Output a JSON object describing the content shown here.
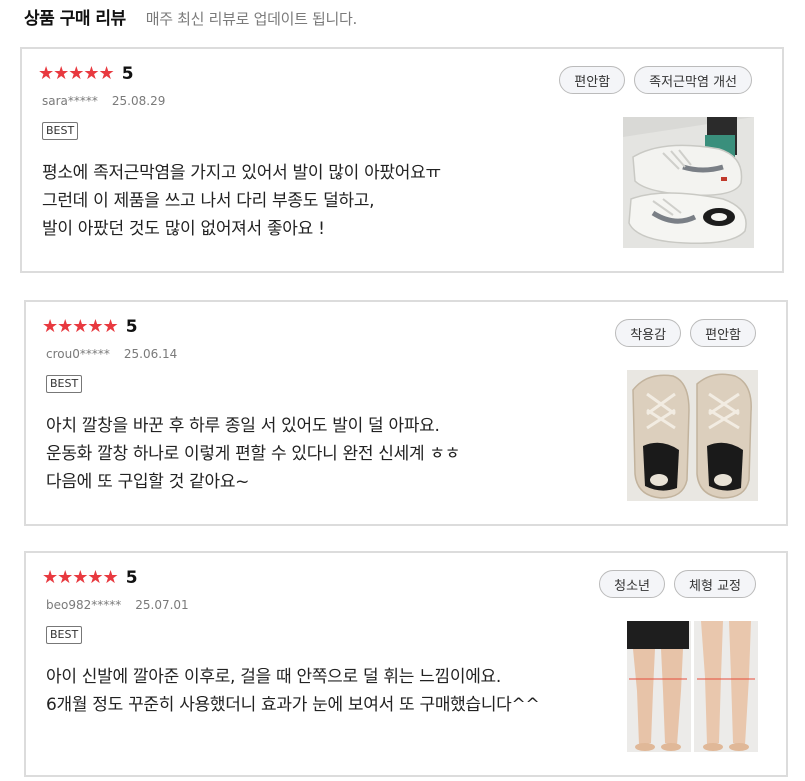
{
  "header": {
    "title": "상품 구매 리뷰",
    "subtitle": "매주 최신 리뷰로 업데이트 됩니다."
  },
  "reviews": [
    {
      "stars": "★★★★★",
      "score": "5",
      "user": "sara*****",
      "date": "25.08.29",
      "badge": "BEST",
      "tags": [
        "편안함",
        "족저근막염 개선"
      ],
      "lines": [
        "평소에 족저근막염을 가지고 있어서 발이 많이 아팠어요ㅠ",
        "그런데 이 제품을 쓰고 나서 다리 부종도 덜하고,",
        "발이 아팠던 것도 많이 없어져서 좋아요 !"
      ]
    },
    {
      "stars": "★★★★★",
      "score": "5",
      "user": "crou0*****",
      "date": "25.06.14",
      "badge": "BEST",
      "tags": [
        "착용감",
        "편안함"
      ],
      "lines": [
        "아치 깔창을 바꾼 후 하루 종일 서 있어도 발이 덜 아파요.",
        "운동화 깔창 하나로 이렇게 편할 수 있다니 완전 신세계 ㅎㅎ",
        "다음에 또 구입할 것 같아요~"
      ]
    },
    {
      "stars": "★★★★★",
      "score": "5",
      "user": "beo982*****",
      "date": "25.07.01",
      "badge": "BEST",
      "tags": [
        "청소년",
        "체형 교정"
      ],
      "lines": [
        "아이 신발에 깔아준 이후로, 걸을 때 안쪽으로 덜 휘는 느낌이에요.",
        "6개월 정도 꾸준히 사용했더니 효과가 눈에 보여서 또 구매했습니다^^"
      ]
    }
  ],
  "colors": {
    "star": "#e8393f",
    "tag_bg": "#f4f5f8",
    "border": "#dcdcdc"
  }
}
